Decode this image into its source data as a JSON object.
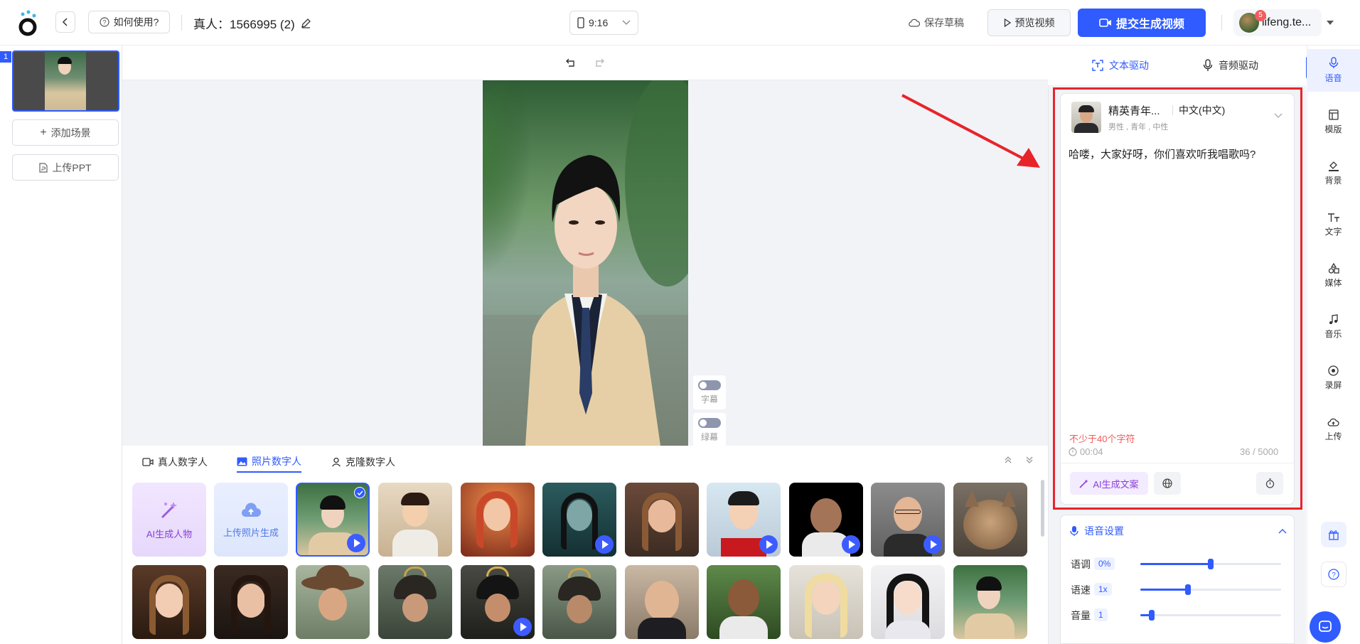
{
  "header": {
    "back_label": "<",
    "help_label": "如何使用?",
    "project_title": "真人：1566995 (2)",
    "ratio": "9:16",
    "save_draft_label": "保存草稿",
    "preview_label": "预览视频",
    "submit_label": "提交生成视频",
    "username": "lifeng.te...",
    "notification_count": "5"
  },
  "scenes": {
    "index": "1",
    "add_scene_label": "添加场景",
    "upload_ppt_label": "上传PPT"
  },
  "canvas_toggles": {
    "subtitle_label": "字幕",
    "greenscreen_label": "绿幕"
  },
  "avatar_tabs": [
    {
      "label": "真人数字人"
    },
    {
      "label": "照片数字人"
    },
    {
      "label": "克隆数字人"
    }
  ],
  "avatar_actions": {
    "ai_generate_label": "AI生成人物",
    "upload_photo_label": "上传照片生成"
  },
  "drive_tabs": [
    {
      "label": "文本驱动"
    },
    {
      "label": "音频驱动"
    }
  ],
  "voice": {
    "name": "精英青年...",
    "language": "中文(中文)",
    "tags": "男性 , 青年 , 中性"
  },
  "script": {
    "text": "哈喽，大家好呀，你们喜欢听我唱歌吗?",
    "warning": "不少于40个字符",
    "duration": "00:04",
    "count": "36 / 5000",
    "ai_copy_label": "AI生成文案"
  },
  "voice_settings": {
    "title": "语音设置",
    "pitch_label": "语调",
    "pitch_value": "0%",
    "pitch_fraction": 0.5,
    "speed_label": "语速",
    "speed_value": "1x",
    "speed_fraction": 0.34,
    "volume_label": "音量",
    "volume_value": "1",
    "volume_fraction": 0.08
  },
  "rail": [
    {
      "label": "语音",
      "icon": "mic-icon"
    },
    {
      "label": "模版",
      "icon": "template-icon"
    },
    {
      "label": "背景",
      "icon": "paint-bucket-icon"
    },
    {
      "label": "文字",
      "icon": "text-icon"
    },
    {
      "label": "媒体",
      "icon": "shapes-icon"
    },
    {
      "label": "音乐",
      "icon": "music-icon"
    },
    {
      "label": "录屏",
      "icon": "record-icon"
    },
    {
      "label": "上传",
      "icon": "upload-cloud-icon"
    }
  ],
  "colors": {
    "accent": "#2f5bff",
    "highlight_red": "#e8242b",
    "warning_red": "#f05a5a"
  }
}
